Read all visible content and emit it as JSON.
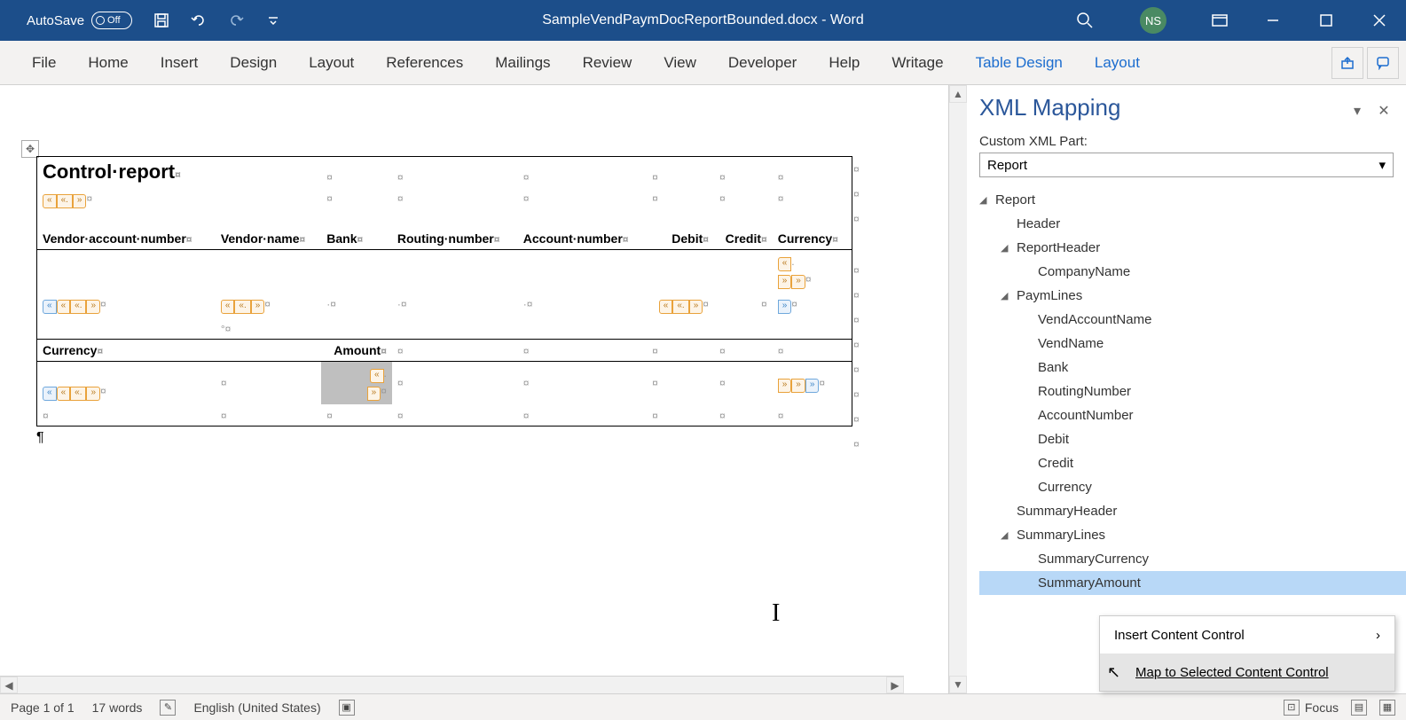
{
  "titlebar": {
    "autosave_label": "AutoSave",
    "autosave_state": "Off",
    "document_title": "SampleVendPaymDocReportBounded.docx  -  Word",
    "user_initials": "NS"
  },
  "ribbon": {
    "tabs": [
      "File",
      "Home",
      "Insert",
      "Design",
      "Layout",
      "References",
      "Mailings",
      "Review",
      "View",
      "Developer",
      "Help",
      "Writage",
      "Table Design",
      "Layout"
    ]
  },
  "document": {
    "title": "Control·report",
    "headers": {
      "vend_account": "Vendor·account·number",
      "vend_name": "Vendor·name",
      "bank": "Bank",
      "routing": "Routing·number",
      "account": "Account·number",
      "debit": "Debit",
      "credit": "Credit",
      "currency": "Currency"
    },
    "summary_headers": {
      "currency": "Currency",
      "amount": "Amount"
    },
    "paragraph_mark": "¶",
    "cell_mark": "¤",
    "dot_mark": "·"
  },
  "xml_pane": {
    "title": "XML Mapping",
    "label": "Custom XML Part:",
    "selected_part": "Report",
    "tree": {
      "root": "Report",
      "header": "Header",
      "report_header": "ReportHeader",
      "company_name": "CompanyName",
      "paym_lines": "PaymLines",
      "paym_children": [
        "VendAccountName",
        "VendName",
        "Bank",
        "RoutingNumber",
        "AccountNumber",
        "Debit",
        "Credit",
        "Currency"
      ],
      "summary_header": "SummaryHeader",
      "summary_lines": "SummaryLines",
      "summary_children": [
        "SummaryCurrency",
        "SummaryAmount"
      ]
    }
  },
  "context_menu": {
    "insert": "Insert Content Control",
    "map": "Map to Selected Content Control"
  },
  "statusbar": {
    "page": "Page 1 of 1",
    "words": "17 words",
    "language": "English (United States)",
    "focus": "Focus"
  }
}
